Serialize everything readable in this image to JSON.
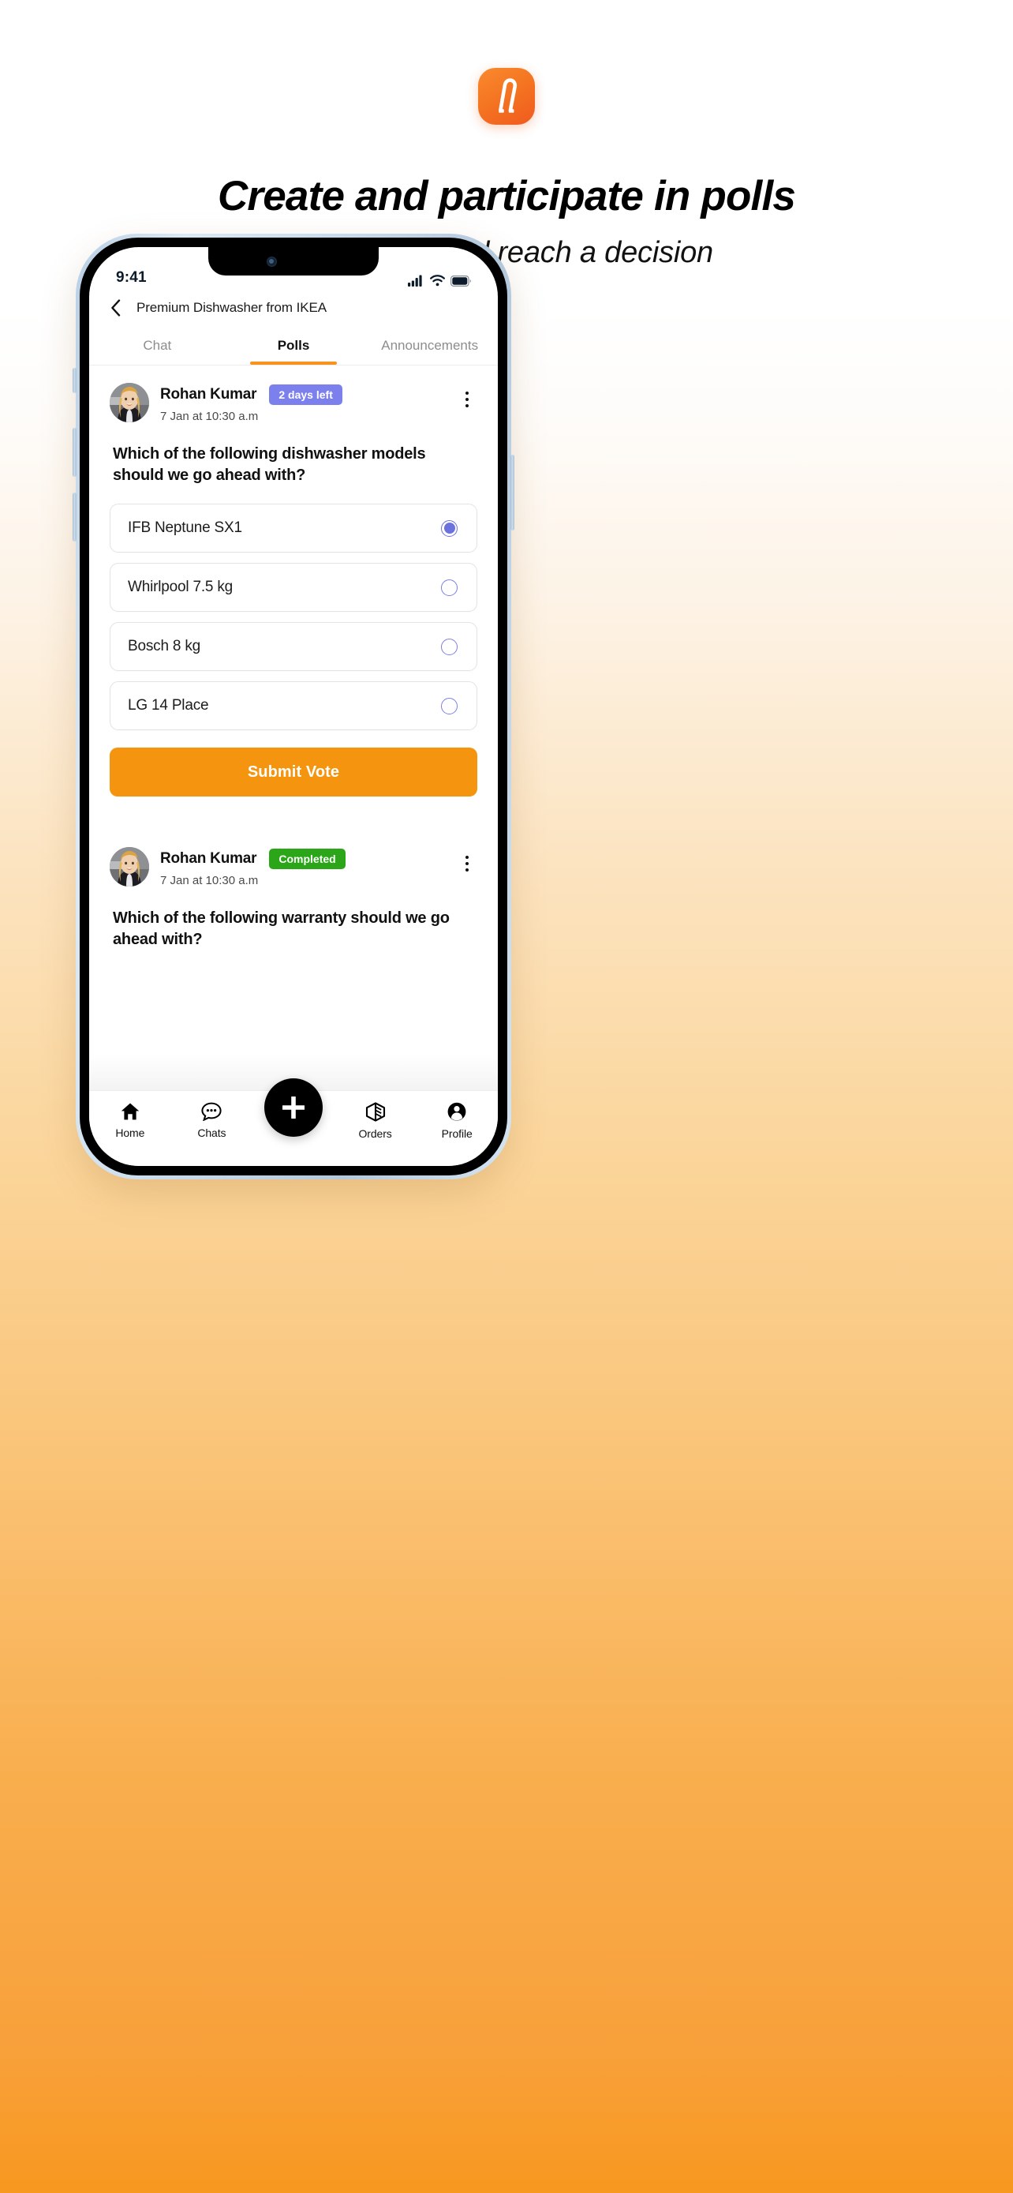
{
  "hero": {
    "logo_icon": "app-logo-icon",
    "title": "Create and participate in polls",
    "subtitle": "to discuss and reach a decision",
    "accent_color": "#f7941d",
    "logo_gradient_from": "#fa8a2e",
    "logo_gradient_to": "#f05a1e"
  },
  "phone": {
    "status_bar": {
      "time": "9:41",
      "cellular_icon": "signal-bars-icon",
      "wifi_icon": "wifi-icon",
      "battery_icon": "battery-full-icon"
    },
    "header": {
      "back_icon": "chevron-left-icon",
      "title": "Premium Dishwasher from IKEA"
    },
    "tabs": [
      {
        "label": "Chat",
        "active": false
      },
      {
        "label": "Polls",
        "active": true
      },
      {
        "label": "Announcements",
        "active": false
      }
    ],
    "polls": [
      {
        "avatar_icon": "user-avatar",
        "author": "Rohan Kumar",
        "status_badge": "2 days left",
        "status_badge_color": "#7b80ec",
        "timestamp": "7 Jan at 10:30 a.m",
        "menu_icon": "kebab-menu-icon",
        "question": "Which of the following dishwasher models should we go ahead with?",
        "options": [
          {
            "label": "IFB Neptune SX1",
            "selected": true
          },
          {
            "label": "Whirlpool 7.5 kg",
            "selected": false
          },
          {
            "label": "Bosch 8 kg",
            "selected": false
          },
          {
            "label": "LG 14 Place",
            "selected": false
          }
        ],
        "submit_label": "Submit Vote",
        "submit_color": "#f5950f"
      },
      {
        "avatar_icon": "user-avatar",
        "author": "Rohan Kumar",
        "status_badge": "Completed",
        "status_badge_color": "#2aa618",
        "timestamp": "7 Jan at 10:30 a.m",
        "menu_icon": "kebab-menu-icon",
        "question": "Which of the following warranty should we go ahead with?",
        "options": [],
        "submit_label": "",
        "submit_color": ""
      }
    ],
    "bottom_nav": {
      "items": [
        {
          "label": "Home",
          "icon": "home-icon"
        },
        {
          "label": "Chats",
          "icon": "chat-bubble-icon"
        },
        {
          "label": "Orders",
          "icon": "package-icon"
        },
        {
          "label": "Profile",
          "icon": "person-icon"
        }
      ],
      "fab_icon": "plus-icon"
    }
  }
}
